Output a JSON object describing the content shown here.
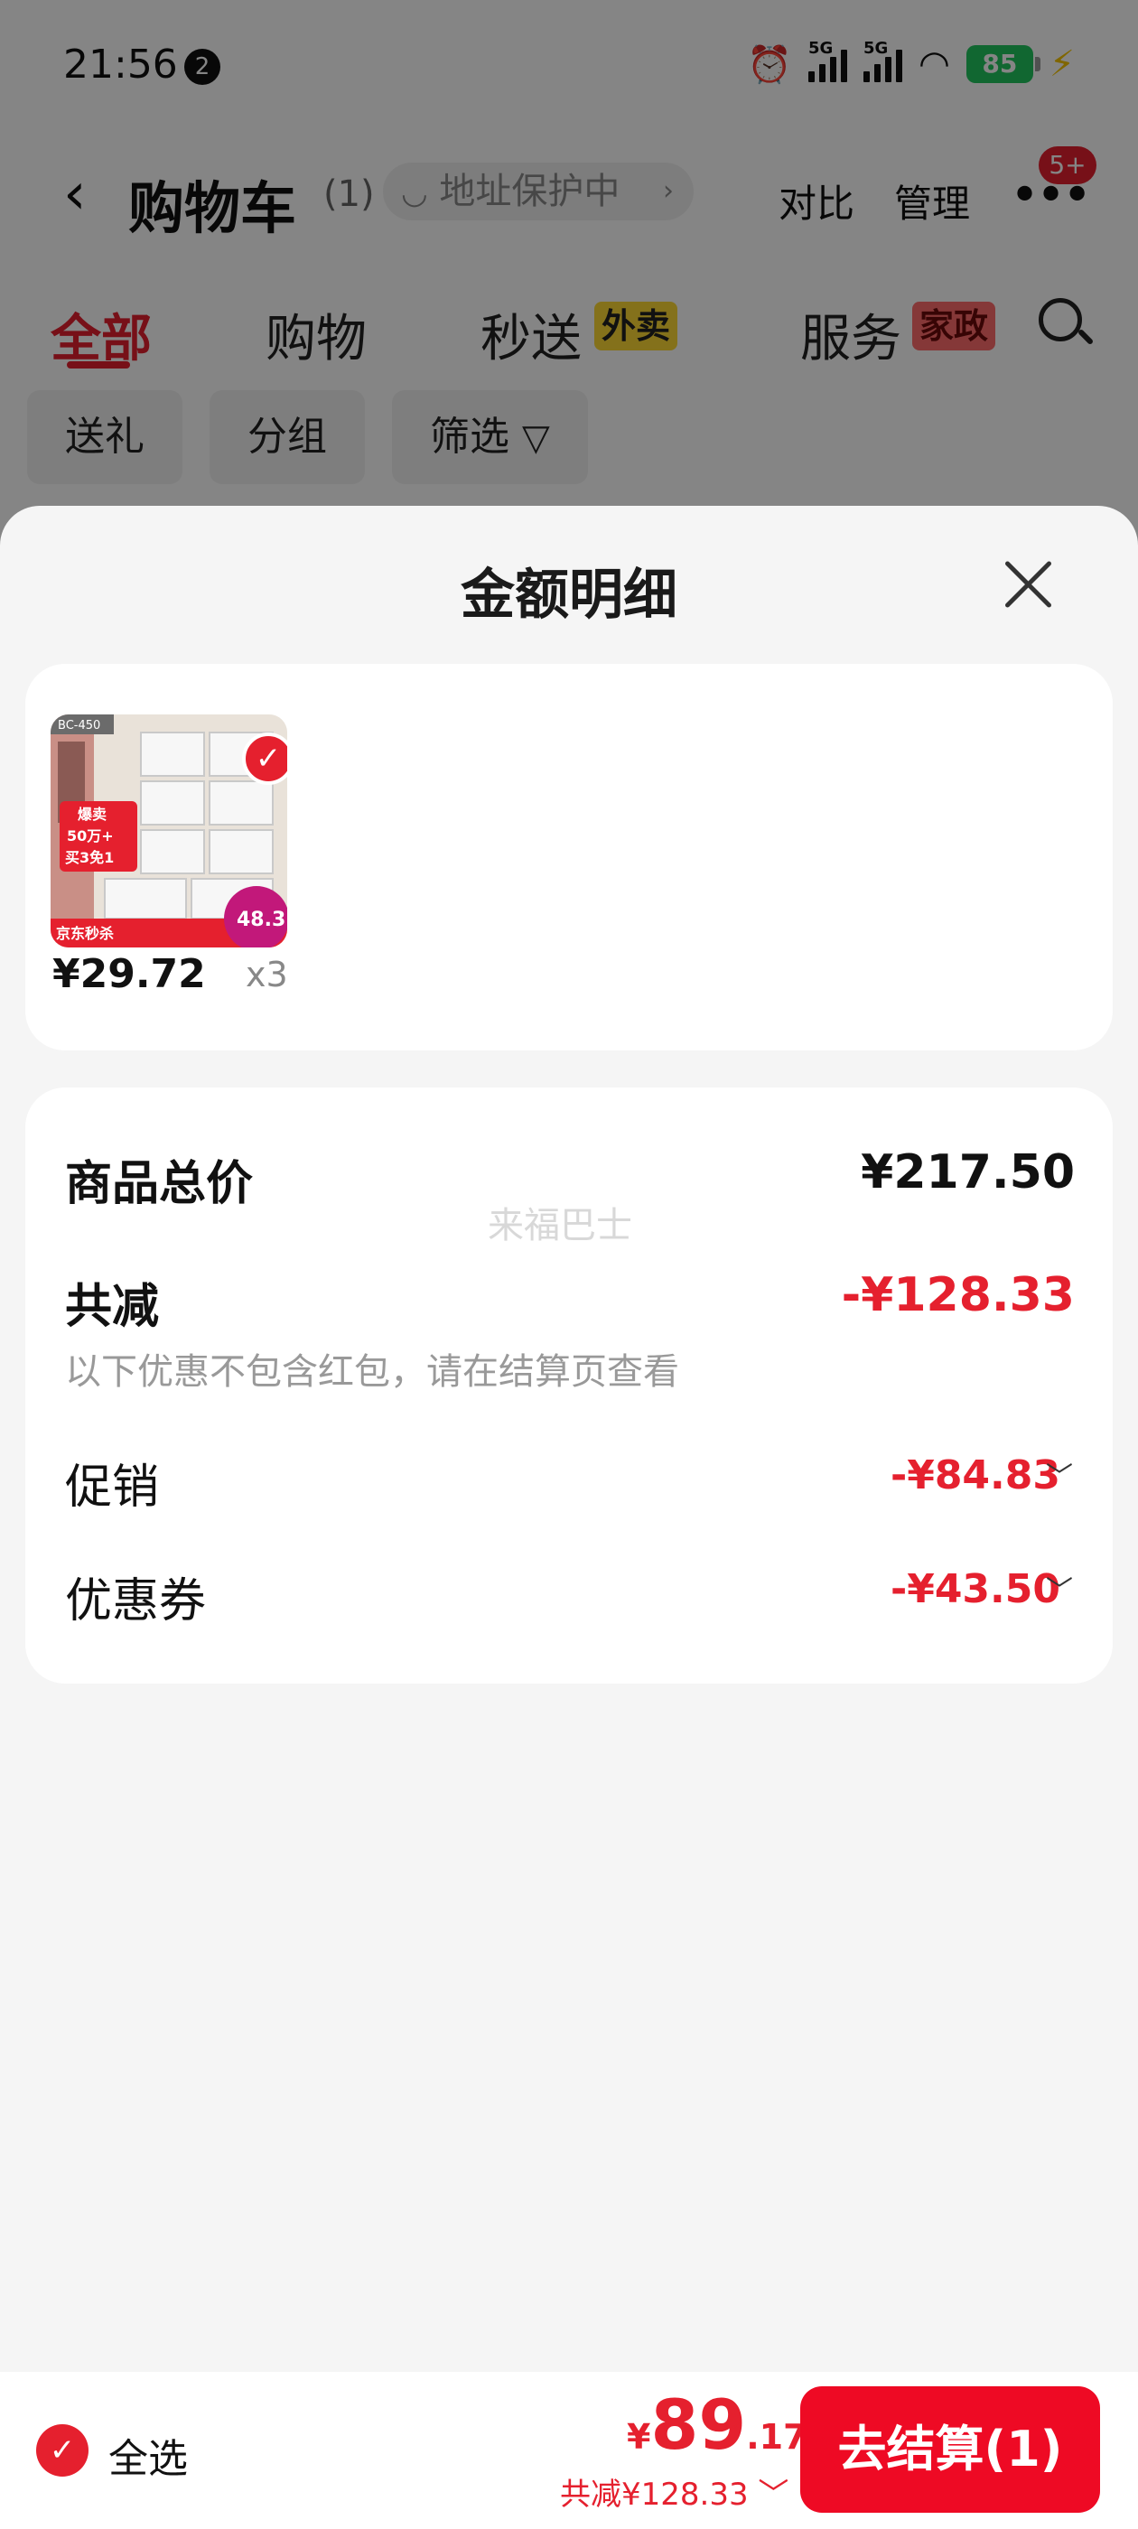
{
  "status_bar": {
    "time": "21:56",
    "notification_count": "2",
    "network_1": "5G",
    "network_2": "5G",
    "battery": "85"
  },
  "nav": {
    "title": "购物车",
    "count": "(1)",
    "address_protect": "地址保护中",
    "compare": "对比",
    "manage": "管理",
    "badge": "5+"
  },
  "tabs": [
    {
      "label": "全部",
      "tag": ""
    },
    {
      "label": "购物",
      "tag": ""
    },
    {
      "label": "秒送",
      "tag": "外卖"
    },
    {
      "label": "服务",
      "tag": "家政"
    }
  ],
  "chips": [
    "送礼",
    "分组",
    "筛选"
  ],
  "sheet": {
    "title": "金额明细",
    "product": {
      "price": "¥29.72",
      "quantity": "x3",
      "image_text": {
        "top": "BC-450",
        "promo": "爆卖\n50万+\n买3免1",
        "brand": "京东秒杀",
        "badge": "48.3"
      }
    },
    "summary": {
      "total_label": "商品总价",
      "total_value": "¥217.50",
      "discount_label": "共减",
      "discount_value": "-¥128.33",
      "note": "以下优惠不包含红包，请在结算页查看",
      "promo_label": "促销",
      "promo_value": "-¥84.83",
      "coupon_label": "优惠券",
      "coupon_value": "-¥43.50",
      "watermark": "来福巴士"
    }
  },
  "checkout": {
    "select_all": "全选",
    "currency": "¥",
    "total_int": "89",
    "total_dec": ".17",
    "discount_summary": "共减¥128.33",
    "pay_button": "去结算(1)"
  },
  "colors": {
    "accent": "#e5202e",
    "pay_button": "#ee0a24",
    "tag_yellow": "#fdd835"
  }
}
